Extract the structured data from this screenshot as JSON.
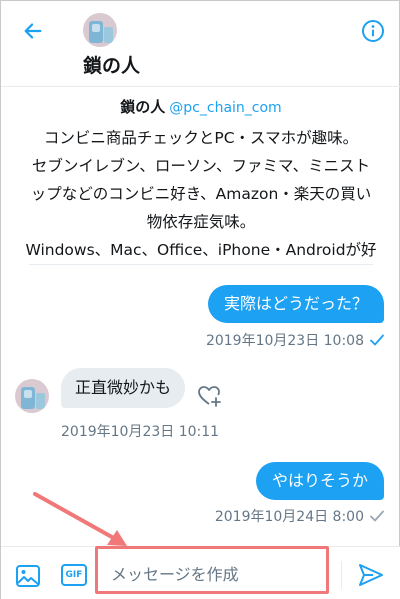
{
  "header": {
    "name": "鎖の人",
    "back_icon": "arrow-left-icon",
    "info_icon": "info-icon"
  },
  "profile": {
    "name": "鎖の人",
    "handle": "@pc_chain_com",
    "bio_lines": [
      "コンビニ商品チェックとPC・スマホが趣味。",
      "セブンイレブン、ローソン、ファミマ、ミニスト",
      "ップなどのコンビニ好き、Amazon・楽天の買い",
      "物依存症気味。",
      "Windows、Mac、Office、iPhone・Androidが好"
    ]
  },
  "messages": [
    {
      "direction": "out",
      "text": "実際はどうだった？",
      "timestamp": "2019年10月23日 10:08",
      "status": "read"
    },
    {
      "direction": "in",
      "text": "正直微妙かも",
      "timestamp": "2019年10月23日 10:11"
    },
    {
      "direction": "out",
      "text": "やはりそうか",
      "timestamp": "2019年10月24日 8:00",
      "status": "sent"
    }
  ],
  "composer": {
    "placeholder": "メッセージを作成",
    "gif_label": "GIF",
    "media_icon": "image-icon",
    "send_icon": "send-icon"
  },
  "colors": {
    "accent": "#1da1f2",
    "incoming_bubble": "#e6ecf0",
    "muted_text": "#657786",
    "annotation": "#f07878"
  }
}
